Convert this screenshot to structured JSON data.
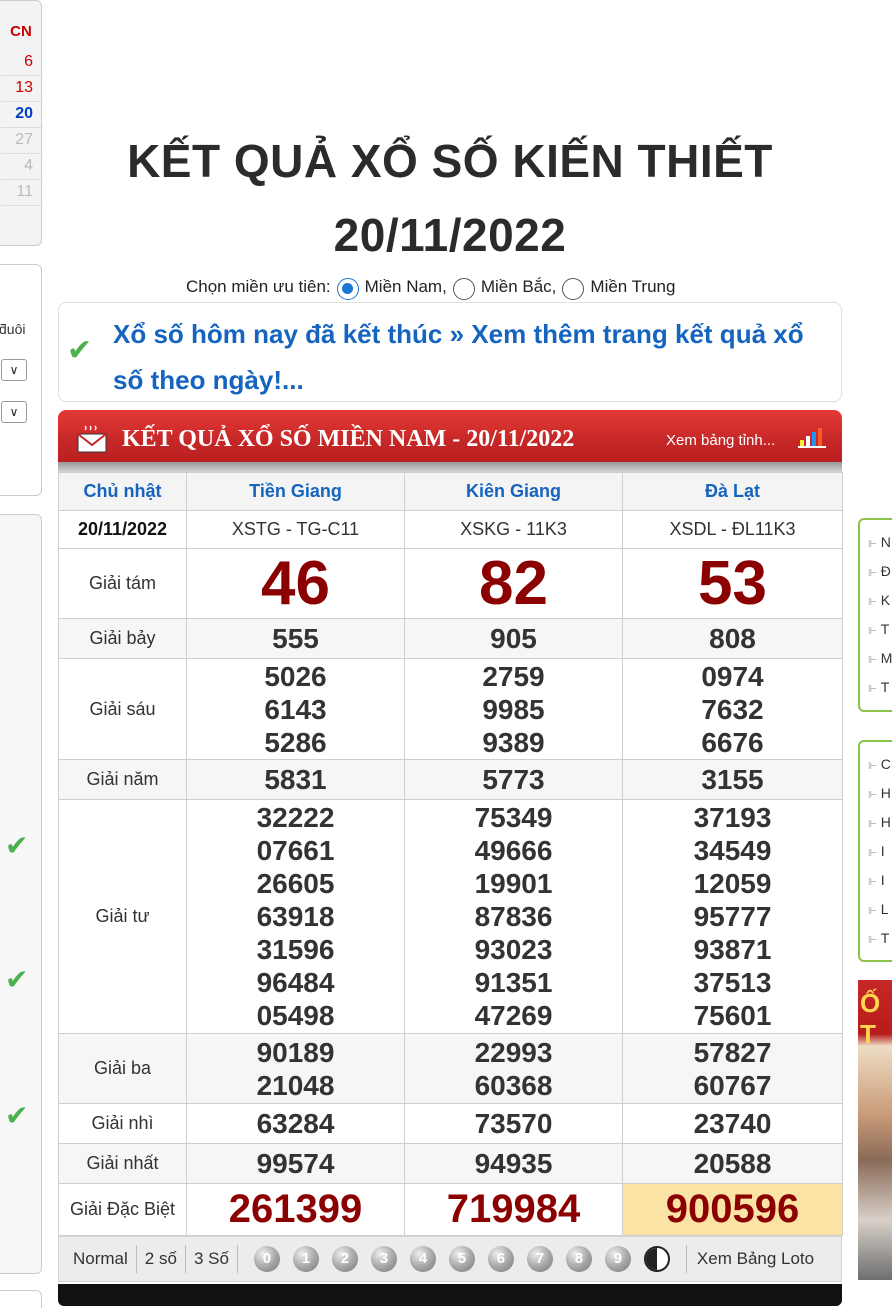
{
  "calendar": {
    "header": "CN",
    "days": [
      "6",
      "13",
      "20",
      "27",
      "4",
      "11"
    ]
  },
  "left_filter": {
    "text": "ƌuôi",
    "select_arrow": "∨"
  },
  "page_title_line1": "KẾT QUẢ XỔ SỐ KIẾN THIẾT",
  "page_title_line2": "20/11/2022",
  "region_pref": {
    "label": "Chọn miền ưu tiên:",
    "options": [
      "Miền Nam,",
      "Miền Bắc,",
      "Miền Trung"
    ],
    "selected_index": 0
  },
  "notice": {
    "text": "Xổ số hôm nay đã kết thúc » Xem thêm trang kết quả xổ số theo ngày!..."
  },
  "panel": {
    "title": "KẾT QUẢ XỔ SỐ MIỀN NAM - 20/11/2022",
    "more_link": "Xem bảng tỉnh..."
  },
  "table": {
    "header": [
      "Chủ nhật",
      "Tiền Giang",
      "Kiên Giang",
      "Đà Lạt"
    ],
    "codes": [
      "20/11/2022",
      "XSTG - TG-C11",
      "XSKG - 11K3",
      "XSDL - ĐL11K3"
    ],
    "prizes": {
      "g8": {
        "label": "Giải tám",
        "values": [
          "46",
          "82",
          "53"
        ]
      },
      "g7": {
        "label": "Giải bảy",
        "values": [
          "555",
          "905",
          "808"
        ]
      },
      "g6": {
        "label": "Giải sáu",
        "values": [
          [
            "5026",
            "6143",
            "5286"
          ],
          [
            "2759",
            "9985",
            "9389"
          ],
          [
            "0974",
            "7632",
            "6676"
          ]
        ]
      },
      "g5": {
        "label": "Giải năm",
        "values": [
          "5831",
          "5773",
          "3155"
        ]
      },
      "g4": {
        "label": "Giải tư",
        "values": [
          [
            "32222",
            "07661",
            "26605",
            "63918",
            "31596",
            "96484",
            "05498"
          ],
          [
            "75349",
            "49666",
            "19901",
            "87836",
            "93023",
            "91351",
            "47269"
          ],
          [
            "37193",
            "34549",
            "12059",
            "95777",
            "93871",
            "37513",
            "75601"
          ]
        ]
      },
      "g3": {
        "label": "Giải ba",
        "values": [
          [
            "90189",
            "21048"
          ],
          [
            "22993",
            "60368"
          ],
          [
            "57827",
            "60767"
          ]
        ]
      },
      "g2": {
        "label": "Giải nhì",
        "values": [
          "63284",
          "73570",
          "23740"
        ]
      },
      "g1": {
        "label": "Giải nhất",
        "values": [
          "99574",
          "94935",
          "20588"
        ]
      },
      "db": {
        "label": "Giải Đặc Biệt",
        "values": [
          "261399",
          "719984",
          "900596"
        ]
      }
    }
  },
  "toolbar": {
    "normal": "Normal",
    "two": "2 số",
    "three": "3 Số",
    "digits": [
      "0",
      "1",
      "2",
      "3",
      "4",
      "5",
      "6",
      "7",
      "8",
      "9"
    ],
    "loto": "Xem Bảng Loto"
  },
  "right_list1": [
    "N",
    "Đ",
    "K",
    "T",
    "M",
    "T"
  ],
  "right_list2": [
    "C",
    "H",
    "H",
    "I",
    "I",
    "L",
    "T"
  ],
  "right_photo_text": "Ố T",
  "colors": {
    "red_header": "#c62828",
    "prize_red": "#8b0000",
    "link_blue": "#1565c0",
    "check_green": "#4caf50",
    "special_highlight": "#fbe3a6"
  }
}
